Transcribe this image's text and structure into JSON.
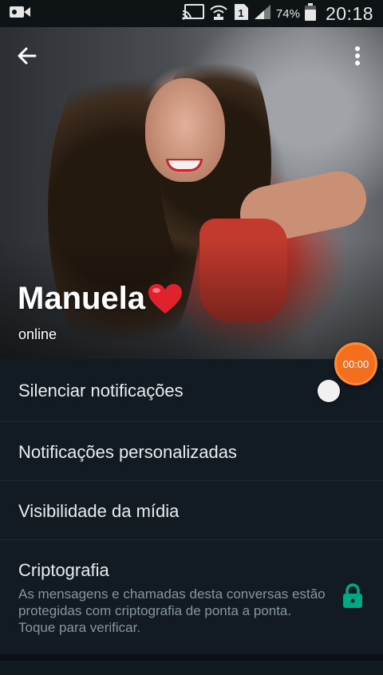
{
  "status_bar": {
    "battery_percent": "74%",
    "time": "20:18",
    "sim_indicator": "1",
    "icons": [
      "video-camera-icon",
      "cast-icon",
      "wifi-calling-icon",
      "sim-icon",
      "signal-icon",
      "battery-icon"
    ]
  },
  "header": {
    "back_icon": "back-arrow-icon",
    "menu_icon": "more-vertical-icon"
  },
  "contact": {
    "name": "Manuela",
    "name_emoji_icon": "red-heart-icon",
    "status": "online"
  },
  "call_timer": "00:00",
  "settings": {
    "mute_label": "Silenciar notificações",
    "mute_enabled": false,
    "custom_notifications_label": "Notificações personalizadas",
    "media_visibility_label": "Visibilidade da mídia",
    "encryption_label": "Criptografia",
    "encryption_description": "As mensagens e chamadas desta conversas estão protegidas com criptografia de ponta a ponta. Toque para verificar.",
    "encryption_icon": "lock-icon"
  },
  "colors": {
    "background": "#111b21",
    "accent_teal": "#00a884",
    "timer_orange": "#f36f1d"
  }
}
